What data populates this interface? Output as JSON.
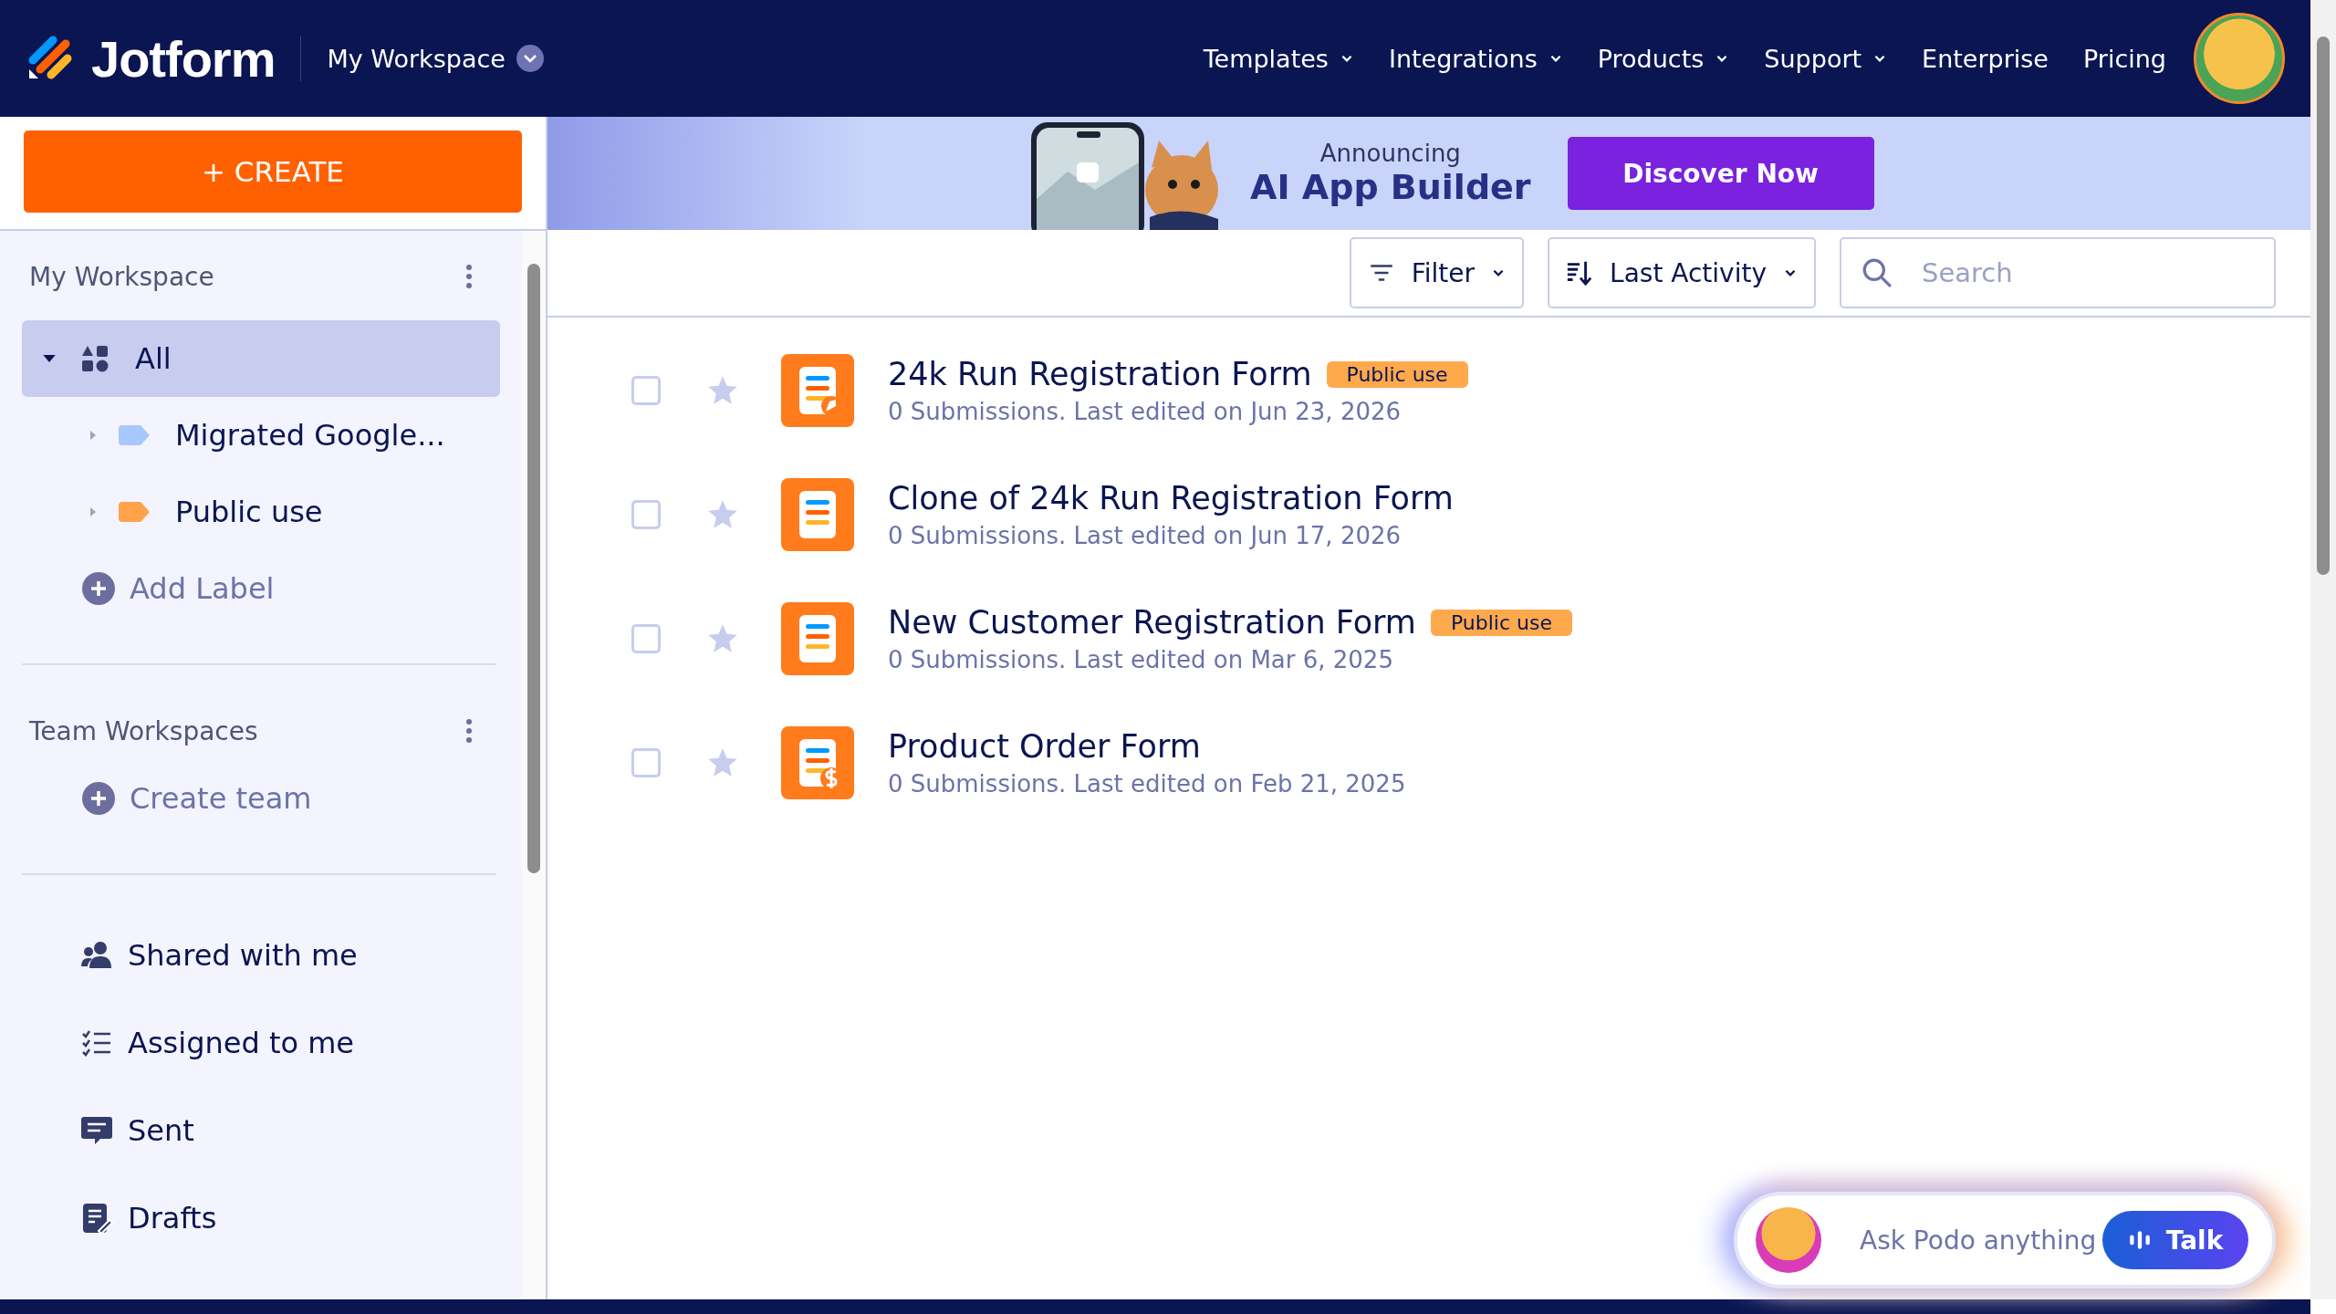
{
  "header": {
    "logo": "Jotform",
    "workspace": "My Workspace",
    "nav": [
      {
        "label": "Templates",
        "dropdown": true
      },
      {
        "label": "Integrations",
        "dropdown": true
      },
      {
        "label": "Products",
        "dropdown": true
      },
      {
        "label": "Support",
        "dropdown": true
      },
      {
        "label": "Enterprise",
        "dropdown": false
      },
      {
        "label": "Pricing",
        "dropdown": false
      }
    ]
  },
  "create_button": "+ CREATE",
  "banner": {
    "kicker": "Announcing",
    "title": "AI App Builder",
    "button": "Discover Now"
  },
  "sidebar": {
    "my_workspace": {
      "title": "My Workspace",
      "items": [
        {
          "label": "All",
          "selected": true,
          "expanded": true,
          "children": [
            {
              "label": "Migrated Google...",
              "color": "#a9c7ff",
              "selected": false
            },
            {
              "label": "Public use",
              "color": "#ffa24a",
              "selected": false
            }
          ]
        }
      ],
      "add_label": "Add Label"
    },
    "team": {
      "title": "Team Workspaces",
      "create": "Create team"
    },
    "links": [
      {
        "label": "Shared with me",
        "kind": "shared"
      },
      {
        "label": "Assigned to me",
        "kind": "assigned"
      },
      {
        "label": "Sent",
        "kind": "sent"
      },
      {
        "label": "Drafts",
        "kind": "drafts"
      }
    ]
  },
  "toolbar": {
    "filter": "Filter",
    "sort": "Last Activity",
    "search": {
      "placeholder": "Search"
    }
  },
  "forms": [
    {
      "title": "24k Run Registration Form",
      "tag": "Public use",
      "meta": "0 Submissions. Last edited on Jun 23, 2026",
      "checked": false,
      "starred": false,
      "kind": "sign"
    },
    {
      "title": "Clone of 24k Run Registration Form",
      "meta": "0 Submissions. Last edited on Jun 17, 2026",
      "checked": false,
      "starred": false,
      "kind": "plain"
    },
    {
      "title": "New Customer Registration Form",
      "tag": "Public use",
      "meta": "0 Submissions. Last edited on Mar 6, 2025",
      "checked": false,
      "starred": false,
      "kind": "plain"
    },
    {
      "title": "Product Order Form",
      "meta": "0 Submissions. Last edited on Feb 21, 2025",
      "checked": false,
      "starred": false,
      "kind": "payment"
    }
  ],
  "assistant": {
    "placeholder": "Ask Podo anything",
    "button": "Talk"
  }
}
